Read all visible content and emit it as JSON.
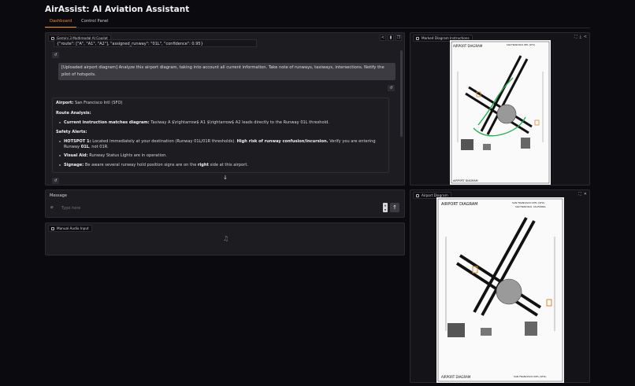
{
  "app": {
    "title": "AirAssist: AI Aviation Assistant"
  },
  "tabs": [
    {
      "label": "Dashboard"
    },
    {
      "label": "Control Panel"
    }
  ],
  "chat": {
    "label": "Gemini 3 Multimodal AI Copilot",
    "json_line": "{\"route\": [\"A\", \"A1\", \"A2\"], \"assigned_runway\": \"01L\", \"confidence\": 0.95}",
    "user_message": "[Uploaded airport diagram] Analyze this airport diagram, taking into account all current information. Take note of runways, taxiways, intersections. Notify the pilot of hotspots.",
    "response": {
      "airport_label": "Airport:",
      "airport_value": " San Francisco Intl (SFO)",
      "route_heading": "Route Analysis:",
      "route_bold": "Current instruction matches diagram:",
      "route_text": " Taxiway A $\\rightarrow$ A1 $\\rightarrow$ A2 leads directly to the Runway 01L threshold.",
      "safety_heading": "Safety Alerts:",
      "hotspot_bold": "HOTSPOT 1:",
      "hotspot_text": " Located immediately at your destination (Runway 01L/01R thresholds). ",
      "hotspot_risk": "High risk of runway confusion/incursion.",
      "hotspot_text2": " Verify you are entering Runway ",
      "hotspot_runway": "01L",
      "hotspot_text3": ", not 01R.",
      "visual_bold": "Visual Aid:",
      "visual_text": " Runway Status Lights are in operation.",
      "signage_bold": "Signage:",
      "signage_text": " Be aware several runway hold position signs are on the ",
      "signage_right": "right",
      "signage_text2": " side at this airport."
    }
  },
  "message": {
    "title": "Message",
    "placeholder": "Type here"
  },
  "audio": {
    "label": "Manual Audio Input"
  },
  "marked": {
    "label": "Marked Diagram Instructions"
  },
  "airport": {
    "label": "Airport Diagram"
  },
  "diagram": {
    "title": "AIRPORT DIAGRAM",
    "airport_name": "SAN FRANCISCO INTL (SFO)",
    "city": "SAN FRANCISCO, CALIFORNIA"
  },
  "colors": {
    "accent": "#f08a24",
    "route": "#1fae4b",
    "hotspot": "#e08a2a"
  }
}
